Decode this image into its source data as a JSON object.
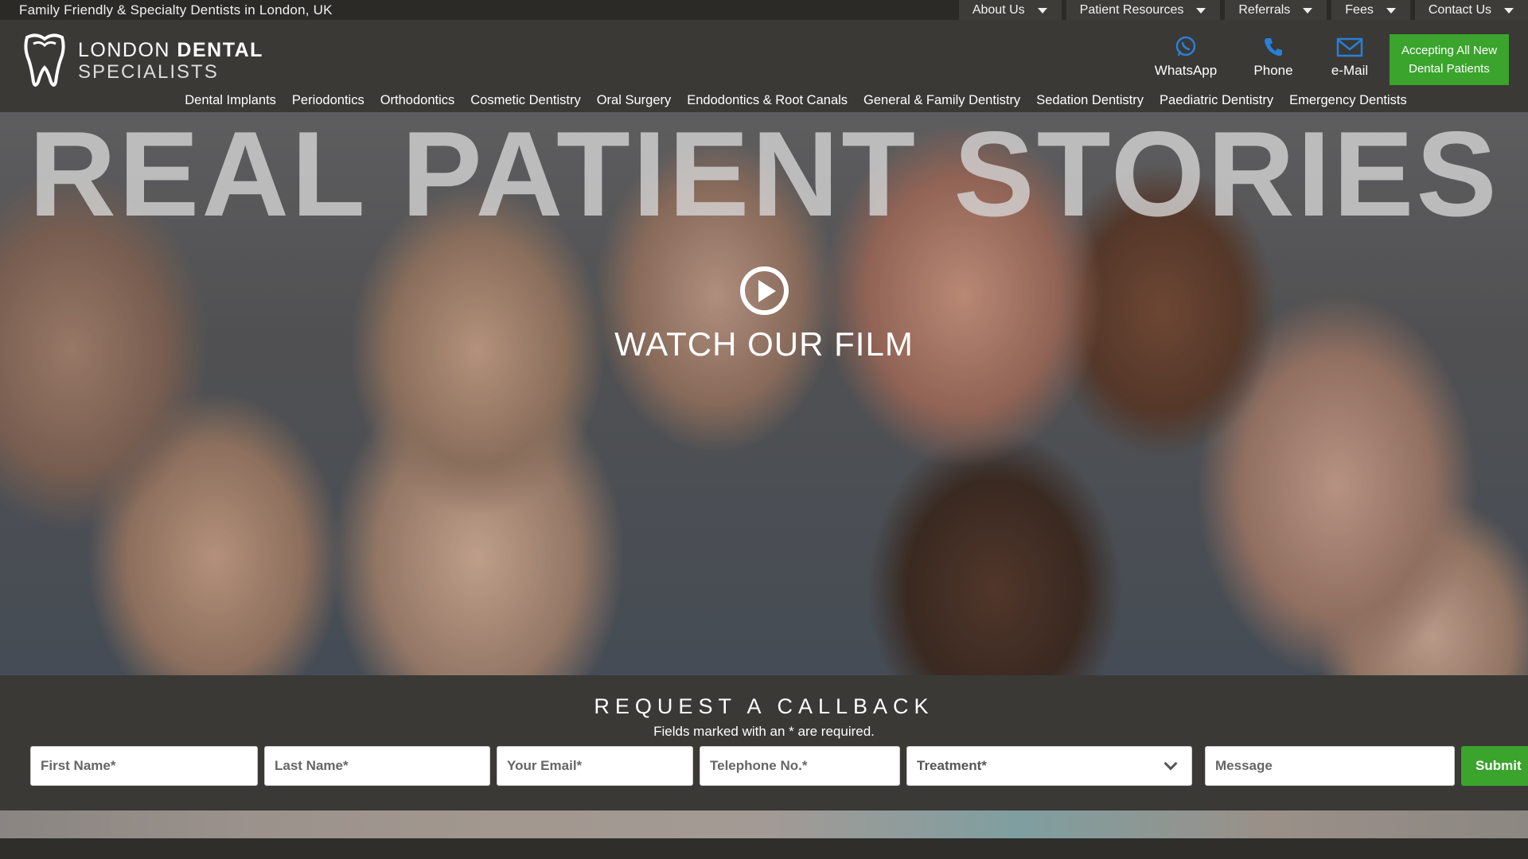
{
  "topbar": {
    "tagline": "Family Friendly & Specialty Dentists in London, UK",
    "nav": [
      {
        "label": "About Us"
      },
      {
        "label": "Patient Resources"
      },
      {
        "label": "Referrals"
      },
      {
        "label": "Fees"
      },
      {
        "label": "Contact Us"
      }
    ]
  },
  "header": {
    "logo": {
      "line1_light": "LONDON ",
      "line1_bold": "DENTAL",
      "line2": "SPECIALISTS"
    },
    "contacts": [
      {
        "label": "WhatsApp",
        "icon": "whatsapp-icon"
      },
      {
        "label": "Phone",
        "icon": "phone-icon"
      },
      {
        "label": "e-Mail",
        "icon": "email-icon"
      }
    ],
    "accept_line1": "Accepting All New",
    "accept_line2": "Dental Patients"
  },
  "mainnav": [
    "Dental Implants",
    "Periodontics",
    "Orthodontics",
    "Cosmetic Dentistry",
    "Oral Surgery",
    "Endodontics & Root Canals",
    "General & Family Dentistry",
    "Sedation Dentistry",
    "Paediatric Dentistry",
    "Emergency Dentists"
  ],
  "hero": {
    "title": "REAL PATIENT STORIES",
    "watch": "WATCH OUR FILM"
  },
  "callback": {
    "title": "REQUEST A CALLBACK",
    "note": "Fields marked with an * are required.",
    "first_name": "First Name*",
    "last_name": "Last Name*",
    "email": "Your Email*",
    "phone": "Telephone No.*",
    "treatment": "Treatment*",
    "message": "Message",
    "submit": "Submit"
  },
  "colors": {
    "accent_green": "#3aa42c",
    "icon_blue": "#2a7fd6",
    "background": "#3a3936"
  }
}
